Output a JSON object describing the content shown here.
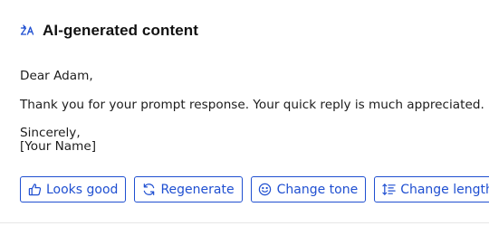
{
  "header": {
    "icon": "ai-sparkle-icon",
    "title": "AI-generated content"
  },
  "email": {
    "greeting": "Dear Adam,",
    "message": "Thank you for your prompt response. Your quick reply is much appreciated.",
    "closing": "Sincerely,",
    "signature": "[Your Name]"
  },
  "actions": [
    {
      "label": "Looks good",
      "icon": "thumbs-up-icon"
    },
    {
      "label": "Regenerate",
      "icon": "refresh-icon"
    },
    {
      "label": "Change tone",
      "icon": "smiley-icon"
    },
    {
      "label": "Change length",
      "icon": "text-length-icon"
    }
  ],
  "colors": {
    "accent": "#1f4fd1",
    "text": "#1c1c1c"
  }
}
